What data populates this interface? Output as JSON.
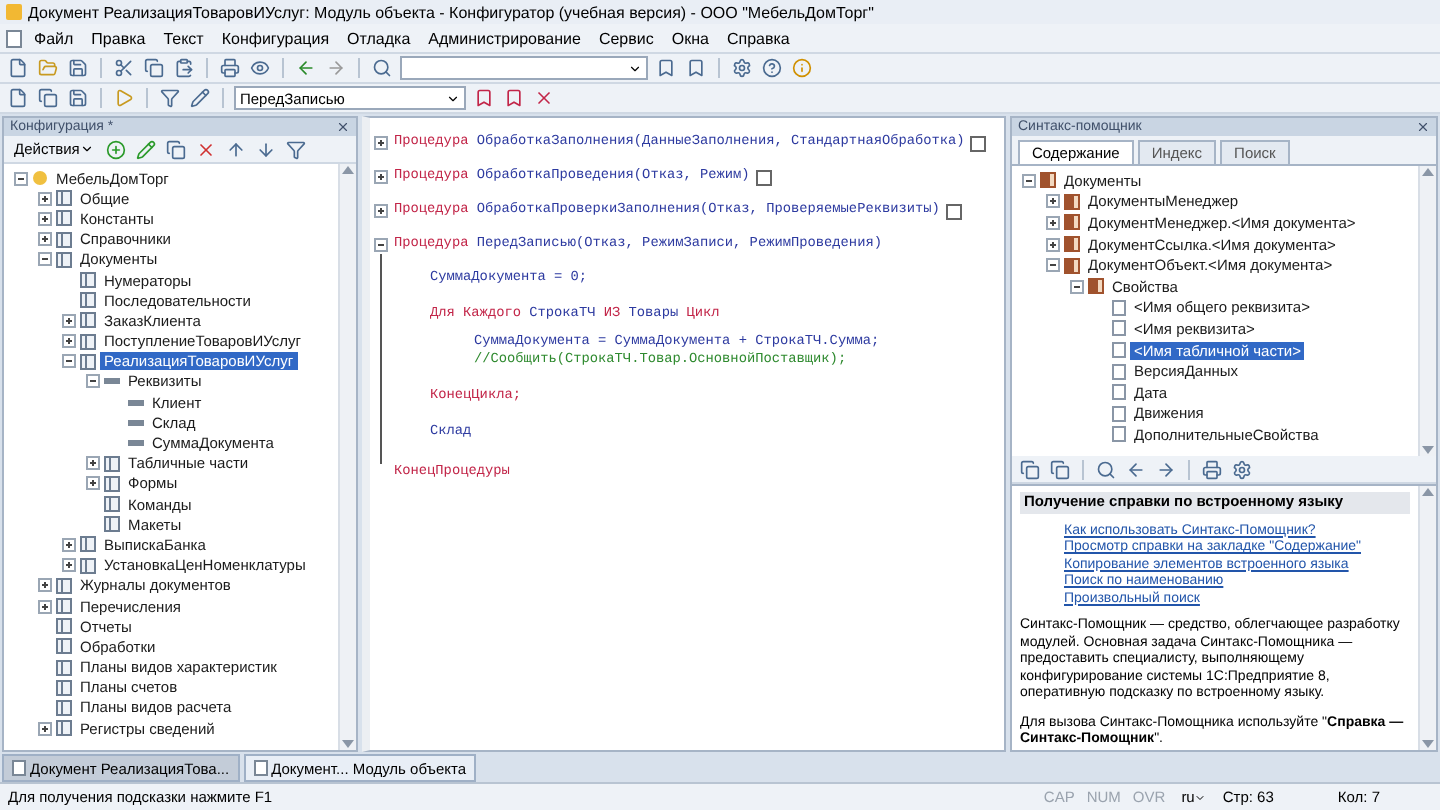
{
  "window": {
    "title": "Документ РеализацияТоваровИУслуг: Модуль объекта - Конфигуратор (учебная версия) - ООО \"МебельДомТорг\""
  },
  "menu": [
    "Файл",
    "Правка",
    "Текст",
    "Конфигурация",
    "Отладка",
    "Администрирование",
    "Сервис",
    "Окна",
    "Справка"
  ],
  "toolbar": {
    "procedure_select": {
      "value": "ПередЗаписью"
    }
  },
  "config_panel": {
    "title": "Конфигурация *",
    "actions_label": "Действия",
    "tree": [
      {
        "label": "МебельДомТорг",
        "kind": "root",
        "selected": false,
        "expanded": true,
        "children": [
          {
            "label": "Общие",
            "kind": "folder",
            "selected": false,
            "expanded": false
          },
          {
            "label": "Константы",
            "kind": "folder",
            "selected": false,
            "expanded": false
          },
          {
            "label": "Справочники",
            "kind": "folder",
            "selected": false,
            "expanded": false
          },
          {
            "label": "Документы",
            "kind": "folder",
            "selected": false,
            "expanded": true,
            "children": [
              {
                "label": "Нумераторы",
                "kind": "folder",
                "selected": false
              },
              {
                "label": "Последовательности",
                "kind": "folder",
                "selected": false
              },
              {
                "label": "ЗаказКлиента",
                "kind": "folder",
                "selected": false,
                "expanded": false
              },
              {
                "label": "ПоступлениеТоваровИУслуг",
                "kind": "folder",
                "selected": false,
                "expanded": false
              },
              {
                "label": "РеализацияТоваровИУслуг",
                "kind": "folder",
                "selected": true,
                "expanded": true,
                "children": [
                  {
                    "label": "Реквизиты",
                    "kind": "attribute",
                    "selected": false,
                    "expanded": true,
                    "children": [
                      {
                        "label": "Клиент",
                        "kind": "attribute",
                        "selected": false
                      },
                      {
                        "label": "Склад",
                        "kind": "attribute",
                        "selected": false
                      },
                      {
                        "label": "СуммаДокумента",
                        "kind": "attribute",
                        "selected": false
                      }
                    ]
                  },
                  {
                    "label": "Табличные части",
                    "kind": "folder",
                    "selected": false,
                    "expanded": false
                  },
                  {
                    "label": "Формы",
                    "kind": "folder",
                    "selected": false,
                    "expanded": false
                  },
                  {
                    "label": "Команды",
                    "kind": "folder",
                    "selected": false
                  },
                  {
                    "label": "Макеты",
                    "kind": "folder",
                    "selected": false
                  }
                ]
              },
              {
                "label": "ВыпискаБанка",
                "kind": "folder",
                "selected": false,
                "expanded": false
              },
              {
                "label": "УстановкаЦенНоменклатуры",
                "kind": "folder",
                "selected": false,
                "expanded": false
              }
            ]
          },
          {
            "label": "Журналы документов",
            "kind": "folder",
            "selected": false,
            "expanded": false
          },
          {
            "label": "Перечисления",
            "kind": "folder",
            "selected": false,
            "expanded": false
          },
          {
            "label": "Отчеты",
            "kind": "folder",
            "selected": false
          },
          {
            "label": "Обработки",
            "kind": "folder",
            "selected": false
          },
          {
            "label": "Планы видов характеристик",
            "kind": "folder",
            "selected": false
          },
          {
            "label": "Планы счетов",
            "kind": "folder",
            "selected": false
          },
          {
            "label": "Планы видов расчета",
            "kind": "folder",
            "selected": false
          },
          {
            "label": "Регистры сведений",
            "kind": "folder",
            "selected": false,
            "expanded": false
          }
        ]
      }
    ]
  },
  "code": {
    "procedures": [
      {
        "expanded": false,
        "header": [
          {
            "kind": "keyword",
            "text": "Процедура"
          },
          {
            "kind": "ident",
            "text": " ОбработкаЗаполнения(ДанныеЗаполнения, СтандартнаяОбработка)"
          }
        ]
      },
      {
        "expanded": false,
        "header": [
          {
            "kind": "keyword",
            "text": "Процедура"
          },
          {
            "kind": "ident",
            "text": " ОбработкаПроведения(Отказ, Режим)"
          }
        ]
      },
      {
        "expanded": false,
        "header": [
          {
            "kind": "keyword",
            "text": "Процедура"
          },
          {
            "kind": "ident",
            "text": " ОбработкаПроверкиЗаполнения(Отказ, ПроверяемыеРеквизиты)"
          }
        ]
      },
      {
        "expanded": true,
        "header": [
          {
            "kind": "keyword",
            "text": "Процедура"
          },
          {
            "kind": "ident",
            "text": " ПередЗаписью(Отказ, РежимЗаписи, РежимПроведения)"
          }
        ],
        "body": [
          {
            "segments": [
              {
                "kind": "ident",
                "text": "СуммаДокумента = 0;"
              }
            ]
          },
          {
            "segments": [
              {
                "kind": "keyword",
                "text": "Для Каждого"
              },
              {
                "kind": "ident",
                "text": " СтрокаТЧ "
              },
              {
                "kind": "keyword",
                "text": "ИЗ"
              },
              {
                "kind": "ident",
                "text": " Товары "
              },
              {
                "kind": "keyword",
                "text": "Цикл"
              }
            ],
            "children": [
              {
                "segments": [
                  {
                    "kind": "ident",
                    "text": "СуммаДокумента = СуммаДокумента + СтрокаТЧ.Сумма;"
                  }
                ]
              },
              {
                "segments": [
                  {
                    "kind": "comment",
                    "text": "//Сообщить(СтрокаТЧ.Товар.ОсновнойПоставщик);"
                  }
                ]
              }
            ]
          },
          {
            "segments": [
              {
                "kind": "keyword",
                "text": "КонецЦикла;"
              }
            ]
          },
          {
            "segments": [
              {
                "kind": "ident",
                "text": "Склад"
              }
            ]
          }
        ],
        "footer": [
          {
            "kind": "keyword",
            "text": "КонецПроцедуры"
          }
        ]
      }
    ]
  },
  "syntax_panel": {
    "title": "Синтакс-помощник",
    "tabs": [
      {
        "label": "Содержание",
        "selected": true
      },
      {
        "label": "Индекс",
        "selected": false
      },
      {
        "label": "Поиск",
        "selected": false
      }
    ],
    "tree": [
      {
        "label": "Документы",
        "kind": "book",
        "selected": false,
        "expanded": true,
        "children": [
          {
            "label": "ДокументыМенеджер",
            "kind": "book",
            "selected": false,
            "expanded": false
          },
          {
            "label": "ДокументМенеджер.<Имя документа>",
            "kind": "book",
            "selected": false,
            "expanded": false
          },
          {
            "label": "ДокументСсылка.<Имя документа>",
            "kind": "book",
            "selected": false,
            "expanded": false
          },
          {
            "label": "ДокументОбъект.<Имя документа>",
            "kind": "book",
            "selected": false,
            "expanded": true,
            "children": [
              {
                "label": "Свойства",
                "kind": "book",
                "selected": false,
                "expanded": true,
                "children": [
                  {
                    "label": "<Имя общего реквизита>",
                    "kind": "page",
                    "selected": false
                  },
                  {
                    "label": "<Имя реквизита>",
                    "kind": "page",
                    "selected": false
                  },
                  {
                    "label": "<Имя табличной части>",
                    "kind": "page",
                    "selected": true
                  },
                  {
                    "label": "ВерсияДанных",
                    "kind": "page",
                    "selected": false
                  },
                  {
                    "label": "Дата",
                    "kind": "page",
                    "selected": false
                  },
                  {
                    "label": "Движения",
                    "kind": "page",
                    "selected": false
                  },
                  {
                    "label": "ДополнительныеСвойства",
                    "kind": "page",
                    "selected": false
                  }
                ]
              }
            ]
          }
        ]
      }
    ],
    "help": {
      "heading": "Получение справки по встроенному языку",
      "links": [
        "Как использовать Синтакс-Помощник?",
        "Просмотр справки на закладке \"Содержание\"",
        "Копирование элементов встроенного языка",
        "Поиск по наименованию",
        "Произвольный поиск"
      ],
      "paragraphs": [
        "Синтакс-Помощник — средство, облегчающее разработку модулей. Основная задача Синтакс-Помощника — предоставить специалисту, выполняющему конфигурирование системы 1С:Предприятие 8, оперативную подсказку по встроенному языку.",
        "Для вызова Синтакс-Помощника используйте \"**Справка — Синтакс-Помощник**\"."
      ]
    }
  },
  "window_tabs": [
    {
      "label": "Документ РеализацияТова...",
      "selected": true
    },
    {
      "label": "Документ... Модуль объекта",
      "selected": false
    }
  ],
  "status_bar": {
    "hint": "Для получения подсказки нажмите F1",
    "indicators": [
      {
        "label": "CAP",
        "on": false
      },
      {
        "label": "NUM",
        "on": false
      },
      {
        "label": "OVR",
        "on": false
      }
    ],
    "language": "ru",
    "line": "Стр: 63",
    "column": "Кол: 7"
  }
}
